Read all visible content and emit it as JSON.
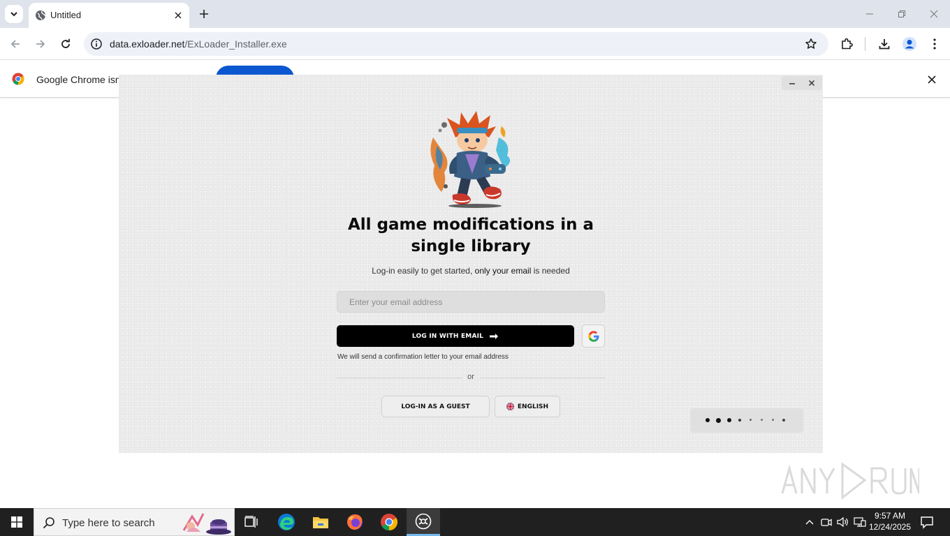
{
  "browser": {
    "tab_title": "Untitled",
    "url_host": "data.exloader.net",
    "url_path": "/ExLoader_Installer.exe",
    "infobar_text": "Google Chrome isn't"
  },
  "app": {
    "headline": "All game modifications in a single library",
    "subline_part1": "Log-in easily to get started, ",
    "subline_strong": "only your email",
    "subline_part2": " is needed",
    "email_placeholder": "Enter your email address",
    "login_email_label": "LOG IN WITH EMAIL",
    "confirmation_note": "We will send a confirmation letter to your email address",
    "or_label": "or",
    "guest_label": "LOG-IN AS A GUEST",
    "language_label": "ENGLISH",
    "pager_active_index": 2,
    "pager_count": 8
  },
  "taskbar": {
    "search_placeholder": "Type here to search",
    "time": "9:57 AM",
    "date": "12/24/2025"
  },
  "colors": {
    "chrome_tabstrip": "#dfe3eb",
    "infobar_button": "#0b57d0",
    "app_background": "#ececec",
    "login_button": "#000000",
    "taskbar": "#202020"
  }
}
